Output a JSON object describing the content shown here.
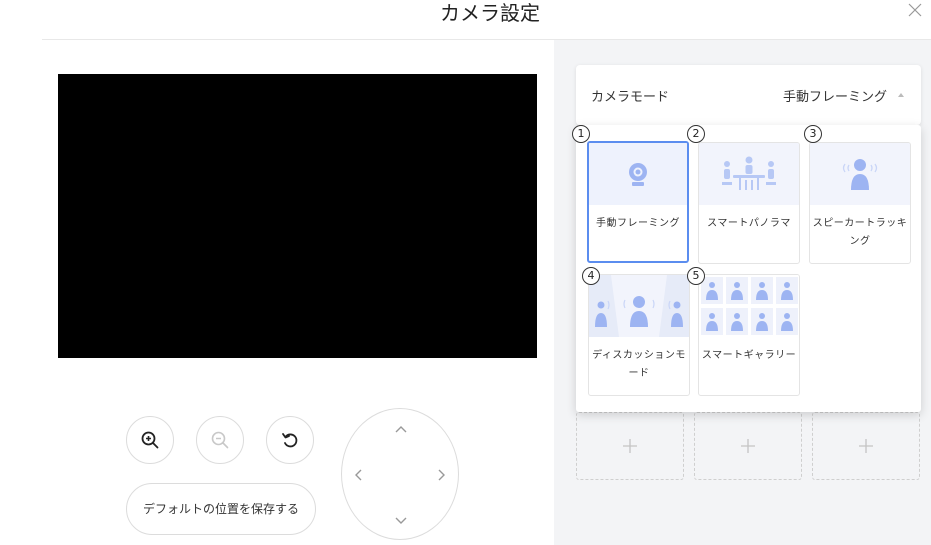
{
  "dialog": {
    "title": "カメラ設定"
  },
  "controls": {
    "save_label": "デフォルトの位置を保存する"
  },
  "mode": {
    "label": "カメラモード",
    "selected": "手動フレーミング",
    "options": [
      {
        "num": "1",
        "label": "手動フレーミング"
      },
      {
        "num": "2",
        "label": "スマートパノラマ"
      },
      {
        "num": "3",
        "label": "スピーカートラッキング"
      },
      {
        "num": "4",
        "label": "ディスカッションモード"
      },
      {
        "num": "5",
        "label": "スマートギャラリー"
      }
    ]
  },
  "colors": {
    "accent": "#5b8def",
    "icon": "#9db4f2",
    "panel": "#f3f4f6"
  },
  "icons": [
    "close-icon",
    "zoom-in-icon",
    "zoom-out-icon",
    "reset-icon",
    "chevron-up-icon",
    "chevron-down-icon",
    "chevron-left-icon",
    "chevron-right-icon",
    "plus-icon",
    "caret-up-icon"
  ]
}
